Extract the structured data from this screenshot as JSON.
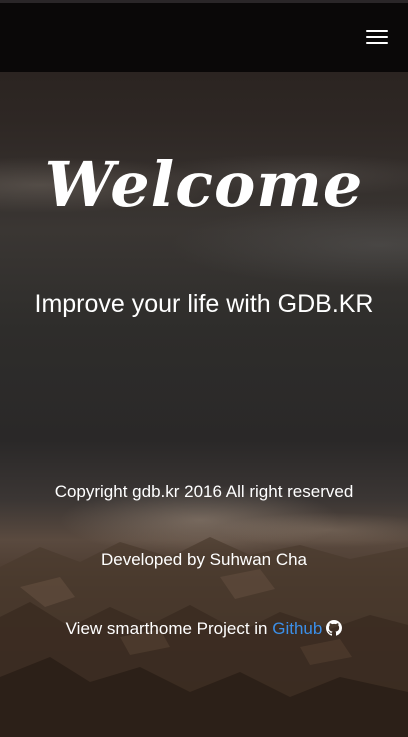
{
  "header": {
    "menu_icon": "hamburger-menu-icon"
  },
  "hero": {
    "title": "Welcome",
    "subtitle": "Improve your life with GDB.KR"
  },
  "footer": {
    "copyright": "Copyright gdb.kr 2016 All right reserved",
    "developer": "Developed by Suhwan Cha",
    "project_prefix": "View smarthome Project in ",
    "project_link": "Github",
    "project_icon": "github-icon",
    "link_color": "#3b8fe8"
  }
}
